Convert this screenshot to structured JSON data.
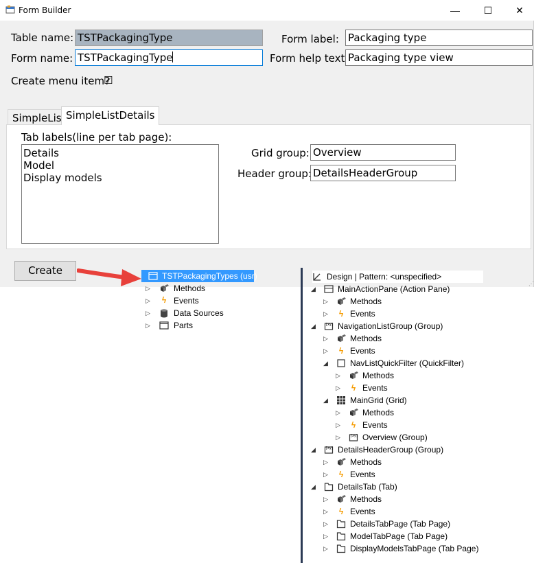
{
  "window": {
    "title": "Form Builder",
    "controls": {
      "minimize": "—",
      "maximize": "☐",
      "close": "✕"
    }
  },
  "form": {
    "table_name_label": "Table name:",
    "table_name_value": "TSTPackagingType",
    "form_name_label": "Form name:",
    "form_name_value": "TSTPackagingType",
    "form_label_label": "Form label:",
    "form_label_value": "Packaging type",
    "form_help_label": "Form help text:",
    "form_help_value": "Packaging type view",
    "create_menu_label": "Create menu item?",
    "create_menu_checked": "☑"
  },
  "tabs": {
    "items": [
      "SimpleList",
      "SimpleListDetails"
    ],
    "active": "SimpleListDetails"
  },
  "details_panel": {
    "tab_labels_caption": "Tab labels(line per tab page):",
    "tab_labels": [
      "Details",
      "Model",
      "Display models"
    ],
    "grid_group_label": "Grid group:",
    "grid_group_value": "Overview",
    "header_group_label": "Header group:",
    "header_group_value": "DetailsHeaderGroup"
  },
  "actions": {
    "create_label": "Create"
  },
  "left_tree": {
    "root": "TSTPackagingTypes (usr)",
    "children": [
      "Methods",
      "Events",
      "Data Sources",
      "Parts"
    ]
  },
  "right_tree": {
    "root": "Design | Pattern: <unspecified>",
    "nodes": [
      "MainActionPane (Action Pane)",
      "Methods",
      "Events",
      "NavigationListGroup (Group)",
      "Methods",
      "Events",
      "NavListQuickFilter (QuickFilter)",
      "Methods",
      "Events",
      "MainGrid (Grid)",
      "Methods",
      "Events",
      "Overview (Group)",
      "DetailsHeaderGroup (Group)",
      "Methods",
      "Events",
      "DetailsTab (Tab)",
      "Methods",
      "Events",
      "DetailsTabPage (Tab Page)",
      "ModelTabPage (Tab Page)",
      "DisplayModelsTabPage (Tab Page)"
    ]
  },
  "colors": {
    "selection": "#3399ff",
    "arrow": "#e8413b",
    "readonly_field": "#a8b4c0",
    "events_icon": "#f59b00"
  }
}
